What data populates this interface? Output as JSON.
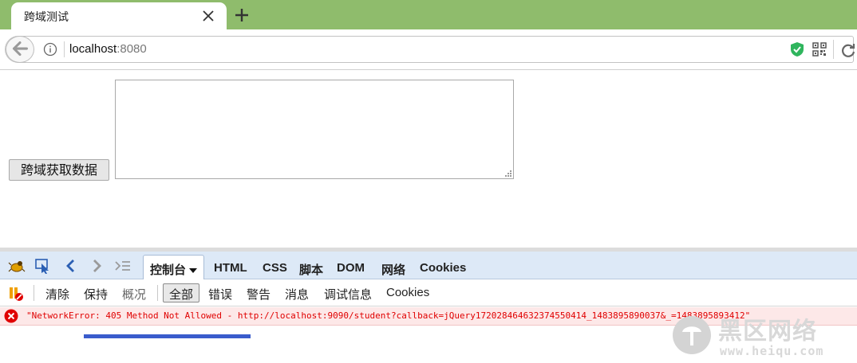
{
  "browser": {
    "tab_title": "跨域测试",
    "url_host": "localhost",
    "url_port": ":8080"
  },
  "page": {
    "fetch_button_label": "跨域获取数据",
    "textarea_value": ""
  },
  "devtools": {
    "panel_tabs": [
      "控制台",
      "HTML",
      "CSS",
      "脚本",
      "DOM",
      "网络",
      "Cookies"
    ],
    "active_panel_index": 0,
    "console_actions": [
      "清除",
      "保持",
      "概况"
    ],
    "console_filters": [
      "全部",
      "错误",
      "警告",
      "消息",
      "调试信息",
      "Cookies"
    ],
    "active_filter_index": 0,
    "error_message": "\"NetworkError: 405 Method Not Allowed - http://localhost:9090/student?callback=jQuery17202846463237455041​4_1483895890037&_=1483895893412\""
  },
  "watermark": {
    "title": "黑区网络",
    "url": "www.heiqu.com"
  },
  "colors": {
    "tab_strip": "#8fbc6c",
    "devtools_toolbar": "#dde9f7",
    "error_text": "#e00000",
    "error_row": "#fde8e8",
    "accent_bar": "#3a5ccc"
  }
}
